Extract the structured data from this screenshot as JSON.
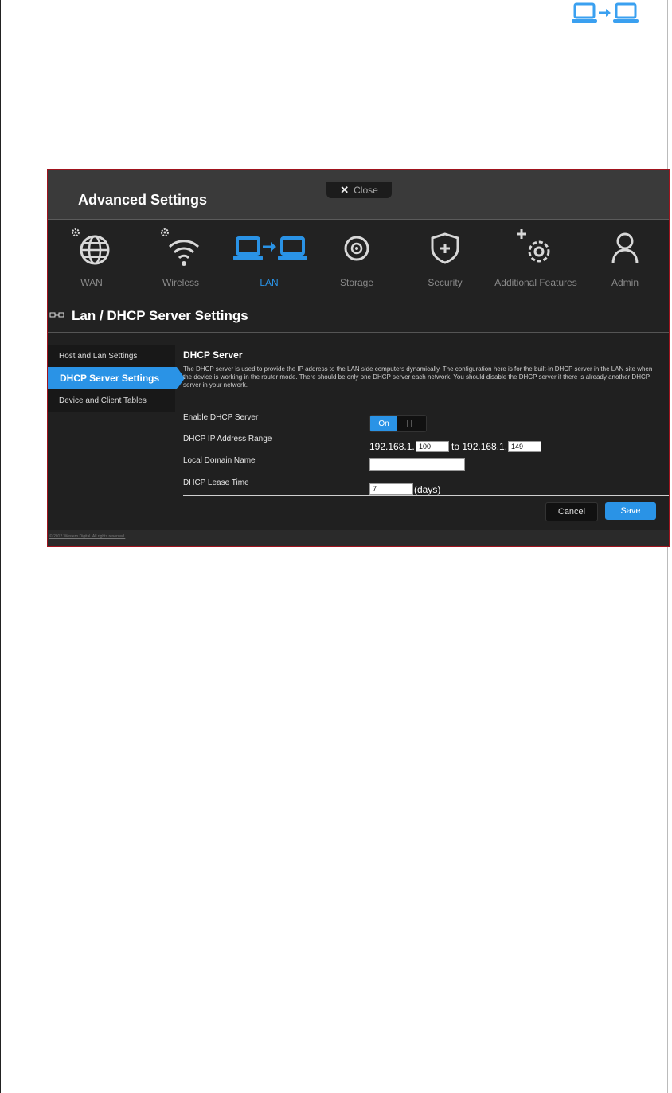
{
  "header": {
    "title": "Advanced Settings",
    "close_label": "Close"
  },
  "nav": {
    "items": [
      {
        "label": "WAN",
        "icon": "globe-icon"
      },
      {
        "label": "Wireless",
        "icon": "wifi-icon"
      },
      {
        "label": "LAN",
        "icon": "lan-icon",
        "active": true
      },
      {
        "label": "Storage",
        "icon": "disc-icon"
      },
      {
        "label": "Security",
        "icon": "shield-icon"
      },
      {
        "label": "Additional Features",
        "icon": "gear-plus-icon"
      },
      {
        "label": "Admin",
        "icon": "user-icon"
      }
    ]
  },
  "section": {
    "title": "Lan / DHCP Server Settings"
  },
  "sidebar": {
    "items": [
      {
        "label": "Host and Lan Settings"
      },
      {
        "label": "DHCP Server Settings",
        "active": true
      },
      {
        "label": "Device and Client Tables"
      }
    ]
  },
  "content": {
    "title": "DHCP Server",
    "description": "The DHCP server is used to provide the IP address to the LAN side computers dynamically. The configuration here is for the built-in DHCP server in the LAN site when the device is working in the router mode. There should be only one DHCP server each network. You should disable the DHCP server if there is already another DHCP server in your network.",
    "enable_label": "Enable DHCP Server",
    "toggle_on": "On",
    "range_label": "DHCP IP Address Range",
    "range_prefix": "192.168.1.",
    "range_start": "100",
    "range_to": "to 192.168.1.",
    "range_end": "149",
    "domain_label": "Local Domain Name",
    "domain_value": "",
    "lease_label": "DHCP Lease Time",
    "lease_value": "7",
    "lease_unit": "(days)"
  },
  "buttons": {
    "cancel": "Cancel",
    "save": "Save"
  },
  "footer": {
    "copyright": "© 2012 Western Digital. All rights reserved."
  },
  "colors": {
    "accent": "#2a93e6",
    "border": "#a0131d",
    "background": "#202020"
  }
}
